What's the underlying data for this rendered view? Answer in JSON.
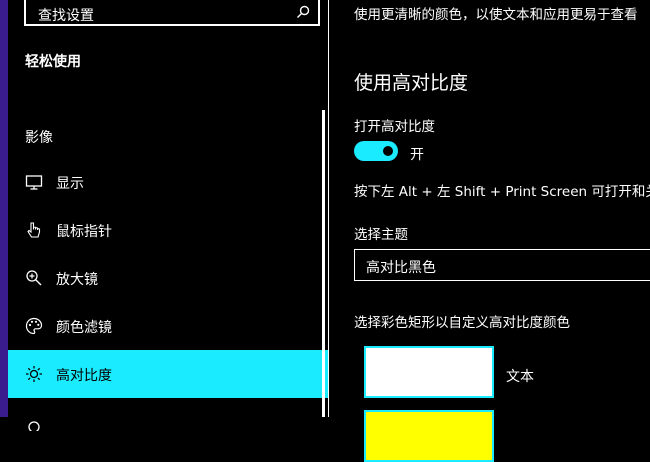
{
  "sidebar": {
    "search_placeholder": "查找设置",
    "section_title": "轻松使用",
    "group_title": "影像",
    "items": [
      {
        "label": "显示",
        "icon": "monitor-icon"
      },
      {
        "label": "鼠标指针",
        "icon": "mouse-pointer-icon"
      },
      {
        "label": "放大镜",
        "icon": "magnifier-icon"
      },
      {
        "label": "颜色滤镜",
        "icon": "color-filter-icon"
      },
      {
        "label": "高对比度",
        "icon": "brightness-icon",
        "active": true
      }
    ]
  },
  "main": {
    "description": "使用更清晰的颜色，以使文本和应用更易于查看",
    "heading": "使用高对比度",
    "toggle_label": "打开高对比度",
    "toggle_state": "开",
    "shortcut_text": "按下左 Alt + 左 Shift + Print Screen 可打开和关闭",
    "theme_label": "选择主题",
    "theme_value": "高对比黑色",
    "customize_label": "选择彩色矩形以自定义高对比度颜色",
    "swatches": [
      {
        "label": "文本",
        "color": "#ffffff"
      },
      {
        "label": "",
        "color": "#ffff00"
      }
    ]
  },
  "colors": {
    "accent": "#1aebff",
    "background": "#000000",
    "left_edge": "#3b1c8f"
  }
}
